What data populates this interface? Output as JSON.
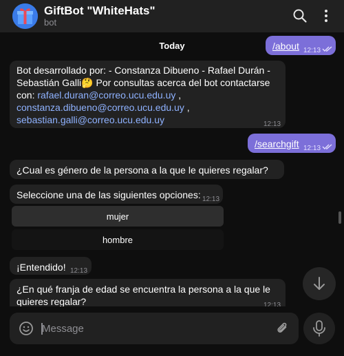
{
  "header": {
    "title": "GiftBot \"WhiteHats\"",
    "subtitle": "bot",
    "avatar_icon": "gift-icon",
    "search_icon": "search-icon",
    "more_icon": "more-vertical-icon"
  },
  "chat": {
    "date_label": "Today",
    "messages": {
      "about_cmd": {
        "text": "/about",
        "time": "12:13"
      },
      "about_reply": {
        "line1": "Bot desarrollado por: - Constanza Dibueno - Rafael Durán -",
        "line2_a": "Sebastián Galli",
        "emoji": "🤔",
        "line2_b": " Por consultas acerca del bot contactarse",
        "line3_a": "con: ",
        "email1": "rafael.duran@correo.ucu.edu.uy",
        "comma1": " ,",
        "email2": "constanza.dibueno@correo.ucu.edu.uy",
        "comma2": " ,",
        "email3": "sebastian.galli@correo.ucu.edu.uy",
        "time": "12:13"
      },
      "search_cmd": {
        "text": "/searchgift",
        "time": "12:13"
      },
      "q_gender": {
        "text": "¿Cual es género de la persona a la que le quieres regalar?"
      },
      "select_opt": {
        "text": "Seleccione una de las siguientes opciones:",
        "time": "12:13"
      },
      "entendido": {
        "text": "¡Entendido!",
        "time": "12:13"
      },
      "q_age": {
        "line1": "¿En qué franja de edad se encuentra la persona a la que le",
        "line2": "quieres regalar?",
        "time": "12:13"
      }
    },
    "keyboard": [
      {
        "label": "mujer"
      },
      {
        "label": "hombre"
      }
    ]
  },
  "composer": {
    "placeholder": "Message",
    "emoji_icon": "emoji-icon",
    "attach_icon": "paperclip-icon",
    "mic_icon": "microphone-icon"
  },
  "colors": {
    "outgoing_bubble": "#7c6fd9",
    "incoming_bubble": "#222222",
    "link": "#8fb2ff",
    "background": "#0e0e0e"
  }
}
